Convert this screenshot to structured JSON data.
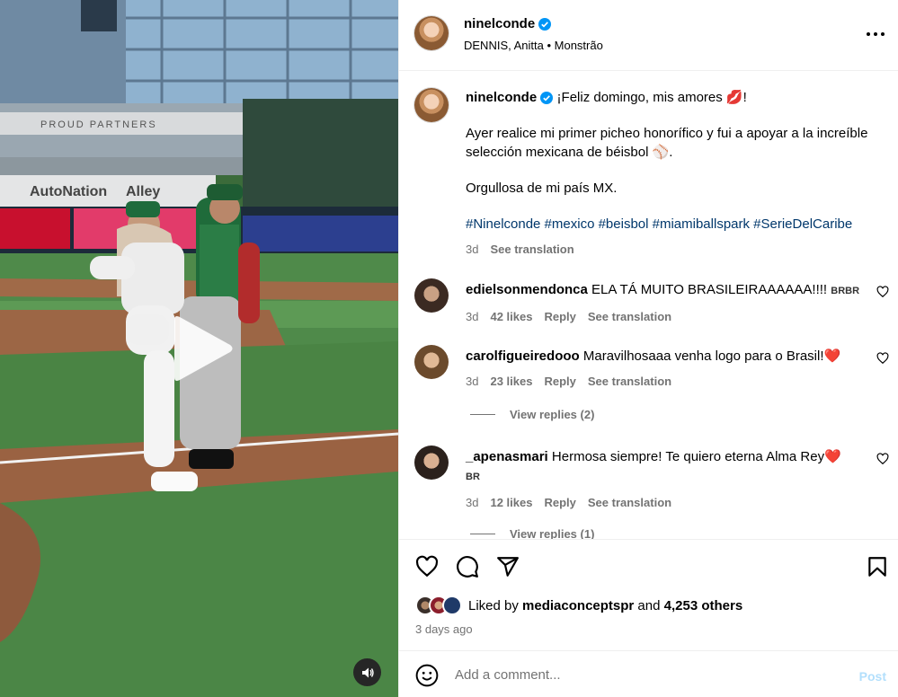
{
  "header": {
    "username": "ninelconde",
    "audio": "DENNIS, Anitta • Monstrão"
  },
  "caption": {
    "username": "ninelconde",
    "line1": "¡Feliz domingo, mis amores 💋!",
    "line2": "Ayer realice mi primer picheo honorífico y fui a apoyar a la increíble selección mexicana de béisbol ⚾.",
    "line3": "Orgullosa de mi país MX.",
    "hashtags": "#Ninelconde #mexico #beisbol #miamiballspark #SerieDelCaribe",
    "age": "3d",
    "see_translation": "See translation"
  },
  "comments": [
    {
      "username": "edielsonmendonca",
      "text": "ELA TÁ MUITO BRASILEIRAAAAAA!!!! ",
      "tag": "BRBR",
      "age": "3d",
      "likes": "42 likes",
      "reply": "Reply",
      "see_translation": "See translation"
    },
    {
      "username": "carolfigueiredooo",
      "text": "Maravilhosaaa venha logo para o Brasil!❤️",
      "age": "3d",
      "likes": "23 likes",
      "reply": "Reply",
      "see_translation": "See translation",
      "view_replies": "View replies (2)"
    },
    {
      "username": "_apenasmari",
      "text": "Hermosa siempre! Te quiero eterna Alma Rey❤️",
      "tag": "BR",
      "age": "3d",
      "likes": "12 likes",
      "reply": "Reply",
      "see_translation": "See translation",
      "view_replies": "View replies (1)"
    }
  ],
  "likes": {
    "prefix": "Liked by ",
    "user": "mediaconceptspr",
    "middle": " and ",
    "count": "4,253 others"
  },
  "date": "3 days ago",
  "add_comment": {
    "placeholder": "Add a comment...",
    "post": "Post"
  },
  "media": {
    "signs": {
      "proud_partners": "PROUD PARTNERS",
      "autonation": "AutoNation",
      "alley": "Alley"
    }
  },
  "colors": {
    "verified": "#0095f6",
    "hashtag": "#00376b",
    "secondary_text": "#737373",
    "post_disabled": "#b2dffc",
    "heart_emoji": "#e0245e"
  },
  "icons": [
    "verified-icon",
    "more-icon",
    "heart-icon",
    "comment-icon",
    "share-icon",
    "bookmark-icon",
    "emoji-icon",
    "play-icon",
    "audio-icon"
  ]
}
